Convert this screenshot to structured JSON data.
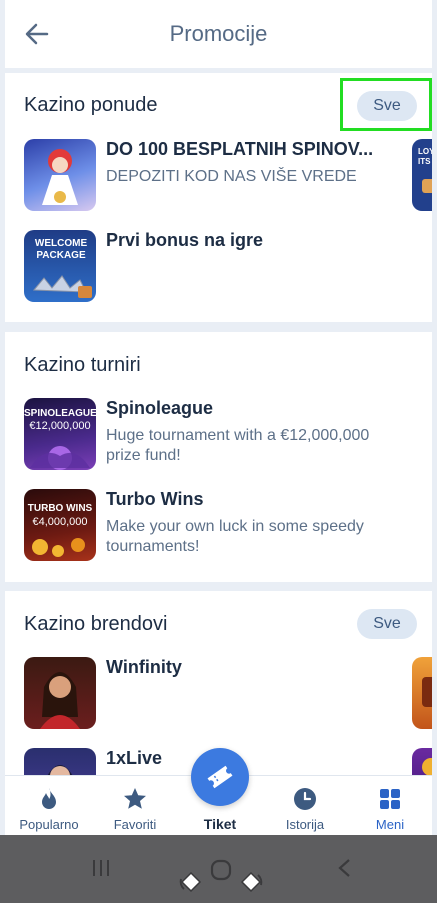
{
  "header": {
    "title": "Promocije",
    "back_icon": "arrow-left-icon"
  },
  "casino_offers": {
    "title": "Kazino ponude",
    "all_label": "Sve",
    "items": [
      {
        "title": "DO 100 BESPLATNIH SPINOV...",
        "subtitle": "DEPOZITI KOD NAS VIŠE VREDE"
      },
      {
        "title": "Prvi bonus na igre",
        "subtitle": "",
        "thumb_text": "WELCOME PACKAGE"
      }
    ],
    "peek_text": "LOYAL ITS W"
  },
  "casino_tournaments": {
    "title": "Kazino turniri",
    "items": [
      {
        "title": "Spinoleague",
        "subtitle": "Huge tournament with a €12,000,000 prize fund!",
        "thumb_text": "SPINOLEAGUE",
        "thumb_amount": "€12,000,000"
      },
      {
        "title": "Turbo Wins",
        "subtitle": "Make your own luck in some speedy tournaments!",
        "thumb_text": "TURBO WINS",
        "thumb_amount": "€4,000,000"
      }
    ]
  },
  "casino_brands": {
    "title": "Kazino brendovi",
    "all_label": "Sve",
    "items": [
      {
        "title": "Winfinity"
      },
      {
        "title": "1xLive"
      }
    ]
  },
  "bottom_nav": {
    "items": [
      {
        "label": "Popularno",
        "icon": "flame-icon"
      },
      {
        "label": "Favoriti",
        "icon": "star-icon"
      },
      {
        "label": "Tiket",
        "icon": "ticket-icon"
      },
      {
        "label": "Istorija",
        "icon": "clock-icon"
      },
      {
        "label": "Meni",
        "icon": "grid-icon"
      }
    ]
  },
  "colors": {
    "accent": "#3c7ae0",
    "title": "#1d2d44",
    "muted": "#5d7088",
    "highlight": "#22dd22"
  }
}
